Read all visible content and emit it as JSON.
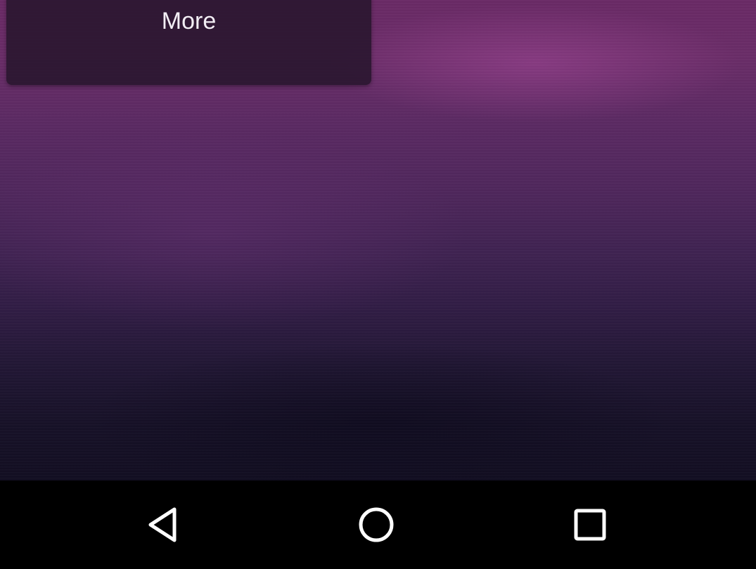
{
  "menu": {
    "more_label": "More"
  },
  "navigation_bar": {
    "buttons": [
      {
        "name": "back",
        "icon": "back-triangle-icon"
      },
      {
        "name": "home",
        "icon": "home-circle-icon"
      },
      {
        "name": "recents",
        "icon": "recents-square-icon"
      }
    ]
  },
  "colors": {
    "wallpaper_top": "#6a2a66",
    "wallpaper_bottom": "#120e22",
    "panel": "#28162d",
    "navbar": "#000000",
    "icon": "#ffffff"
  }
}
